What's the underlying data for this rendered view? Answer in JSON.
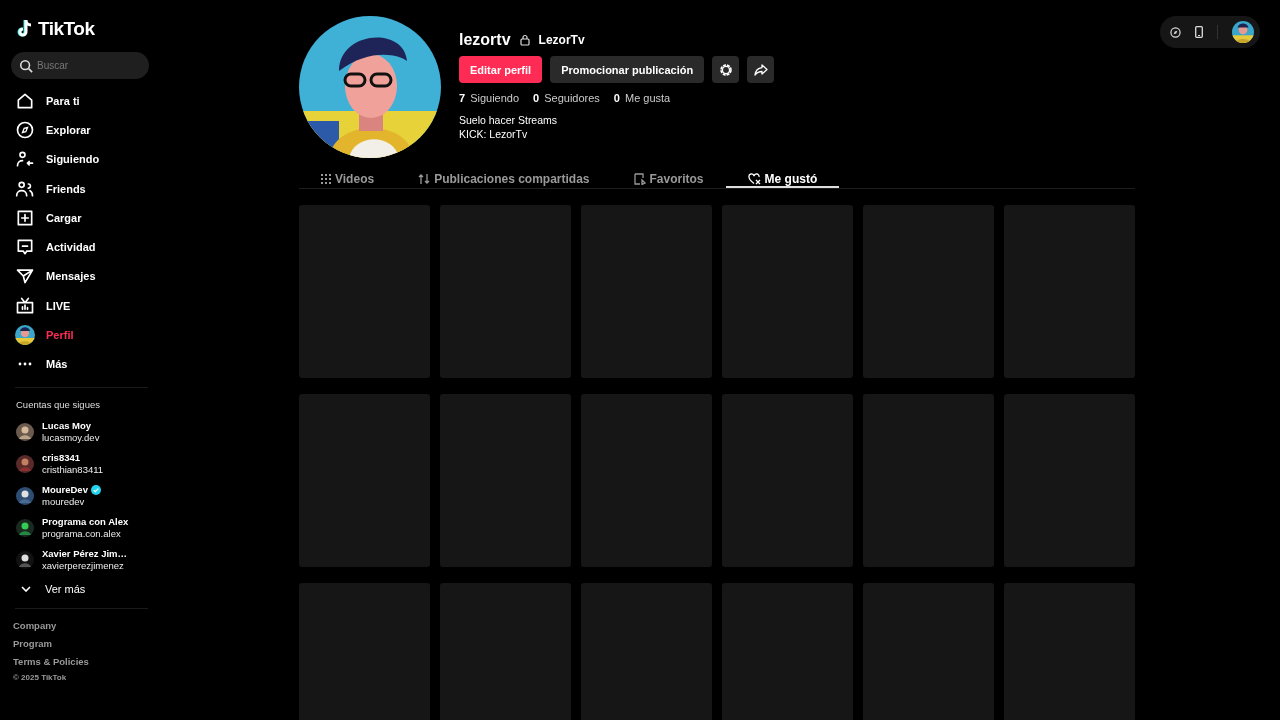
{
  "logo": "TikTok",
  "search": {
    "placeholder": "Buscar"
  },
  "nav": [
    {
      "label": "Para ti",
      "selected": false
    },
    {
      "label": "Explorar",
      "selected": false
    },
    {
      "label": "Siguiendo",
      "selected": false
    },
    {
      "label": "Friends",
      "selected": false
    },
    {
      "label": "Cargar",
      "selected": false
    },
    {
      "label": "Actividad",
      "selected": false
    },
    {
      "label": "Mensajes",
      "selected": false
    },
    {
      "label": "LIVE",
      "selected": false
    },
    {
      "label": "Perfil",
      "selected": true
    },
    {
      "label": "Más",
      "selected": false
    }
  ],
  "following": {
    "title": "Cuentas que sigues",
    "accounts": [
      {
        "name": "Lucas Moy",
        "handle": "lucasmoy.dev",
        "verified": false
      },
      {
        "name": "cris8341",
        "handle": "cristhian83411",
        "verified": false
      },
      {
        "name": "MoureDev",
        "handle": "mouredev",
        "verified": true
      },
      {
        "name": "Programa con Alex",
        "handle": "programa.con.alex",
        "verified": false
      },
      {
        "name": "Xavier Pérez Jim…",
        "handle": "xavierperezjimenez",
        "verified": false
      }
    ],
    "see_more": "Ver más"
  },
  "footer": {
    "links": [
      "Company",
      "Program",
      "Terms & Policies"
    ],
    "copyright": "© 2025 TikTok"
  },
  "profile": {
    "username": "lezortv",
    "private": true,
    "nickname": "LezorTv",
    "buttons": [
      {
        "label": "Editar perfil",
        "kind": "primary"
      },
      {
        "label": "Promocionar publicación",
        "kind": "secondary"
      },
      {
        "kind": "settings"
      },
      {
        "kind": "share"
      }
    ],
    "stats": [
      {
        "count": "7",
        "label": "Siguiendo"
      },
      {
        "count": "0",
        "label": "Seguidores"
      },
      {
        "count": "0",
        "label": "Me gusta"
      }
    ],
    "bio": [
      "Suelo hacer Streams",
      "KICK: LezorTv"
    ]
  },
  "tabs": [
    {
      "label": "Videos",
      "selected": false
    },
    {
      "label": "Publicaciones compartidas",
      "selected": false
    },
    {
      "label": "Favoritos",
      "selected": false
    },
    {
      "label": "Me gustó",
      "selected": true
    }
  ],
  "posts": [
    {
      "kind": "placeholder"
    },
    {
      "kind": "placeholder"
    },
    {
      "kind": "placeholder"
    },
    {
      "kind": "placeholder"
    },
    {
      "kind": "placeholder"
    },
    {
      "kind": "placeholder"
    },
    {
      "kind": "placeholder"
    },
    {
      "kind": "placeholder"
    },
    {
      "kind": "placeholder"
    },
    {
      "kind": "placeholder"
    },
    {
      "kind": "placeholder"
    },
    {
      "kind": "placeholder"
    },
    {
      "kind": "placeholder"
    },
    {
      "kind": "placeholder"
    },
    {
      "kind": "placeholder"
    },
    {
      "kind": "placeholder"
    },
    {
      "kind": "placeholder"
    },
    {
      "kind": "placeholder"
    }
  ],
  "toolbar": [
    {
      "kind": "compass"
    },
    {
      "kind": "phone"
    },
    {
      "kind": "avatar"
    }
  ]
}
